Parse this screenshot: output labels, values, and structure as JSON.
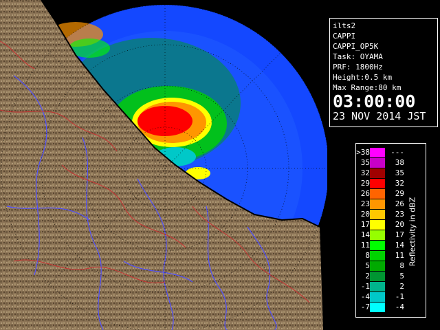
{
  "info": {
    "station": "ilts2",
    "product": "CAPPI",
    "product_code": "CAPPI_OP5K",
    "task": "Task: OYAMA",
    "prf": "PRF: 1800Hz",
    "height": "Height:0.5 km",
    "max_range": "Max Range:80 km",
    "time": "03:00:00",
    "date": "23 NOV 2014 JST"
  },
  "legend": {
    "unit_label": "Reflectivity in dBZ",
    "rows": [
      {
        "low": ">38",
        "high": "---",
        "color": "#ff00ff"
      },
      {
        "low": "35",
        "high": "38",
        "color": "#c800c8"
      },
      {
        "low": "32",
        "high": "35",
        "color": "#a00000"
      },
      {
        "low": "29",
        "high": "32",
        "color": "#ff0000"
      },
      {
        "low": "26",
        "high": "29",
        "color": "#ff6400"
      },
      {
        "low": "23",
        "high": "26",
        "color": "#ff9600"
      },
      {
        "low": "20",
        "high": "23",
        "color": "#ffc800"
      },
      {
        "low": "17",
        "high": "20",
        "color": "#ffff00"
      },
      {
        "low": "14",
        "high": "17",
        "color": "#96ff00"
      },
      {
        "low": "11",
        "high": "14",
        "color": "#00ff00"
      },
      {
        "low": "8",
        "high": "11",
        "color": "#00d200"
      },
      {
        "low": "5",
        "high": "8",
        "color": "#00aa00"
      },
      {
        "low": "2",
        "high": "5",
        "color": "#009632"
      },
      {
        "low": "-1",
        "high": "2",
        "color": "#00b48c"
      },
      {
        "low": "-4",
        "high": "-1",
        "color": "#00c8c8"
      },
      {
        "low": "-7",
        "high": "-4",
        "color": "#00ffff"
      }
    ]
  },
  "colors": {
    "ocean": "#0000ff",
    "echo_blue": "#1e6eff",
    "land": "#8b7355",
    "rivers": "#5050ff",
    "boundaries": "#c83232",
    "background": "#000000"
  }
}
